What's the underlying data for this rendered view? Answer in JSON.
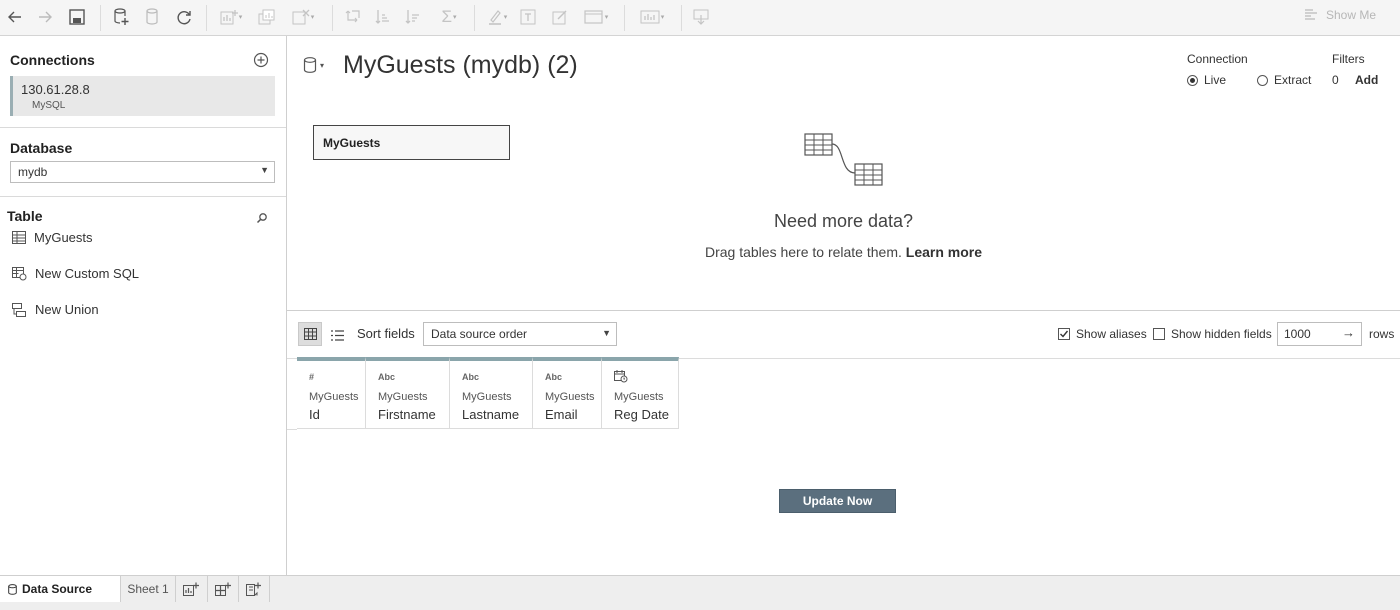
{
  "toolbar": {
    "show_me": "Show Me"
  },
  "sidebar": {
    "connections_title": "Connections",
    "connection": {
      "host": "130.61.28.8",
      "type": "MySQL"
    },
    "database_title": "Database",
    "database_value": "mydb",
    "table_title": "Table",
    "items": [
      {
        "label": "MyGuests",
        "icon": "table-icon"
      },
      {
        "label": "New Custom SQL",
        "icon": "custom-sql-icon"
      },
      {
        "label": "New Union",
        "icon": "union-icon"
      }
    ]
  },
  "datasource": {
    "title": "MyGuests (mydb) (2)",
    "connection_label": "Connection",
    "live_label": "Live",
    "extract_label": "Extract",
    "connection_selected": "Live",
    "filters_label": "Filters",
    "filters_count": "0",
    "filters_add": "Add",
    "table_box": "MyGuests",
    "need_more_title": "Need more data?",
    "need_more_text": "Drag tables here to relate them.",
    "learn_more": "Learn more"
  },
  "gridbar": {
    "sort_label": "Sort fields",
    "sort_value": "Data source order",
    "show_aliases": "Show aliases",
    "show_aliases_checked": true,
    "show_hidden": "Show hidden fields",
    "show_hidden_checked": false,
    "rows_value": "1000",
    "rows_label": "rows"
  },
  "columns": [
    {
      "type": "#",
      "source": "MyGuests",
      "name": "Id"
    },
    {
      "type": "Abc",
      "source": "MyGuests",
      "name": "Firstname"
    },
    {
      "type": "Abc",
      "source": "MyGuests",
      "name": "Lastname"
    },
    {
      "type": "Abc",
      "source": "MyGuests",
      "name": "Email"
    },
    {
      "type": "date-time",
      "source": "MyGuests",
      "name": "Reg Date"
    }
  ],
  "update_button": "Update Now",
  "tabs": {
    "data_source": "Data Source",
    "sheet1": "Sheet 1"
  }
}
